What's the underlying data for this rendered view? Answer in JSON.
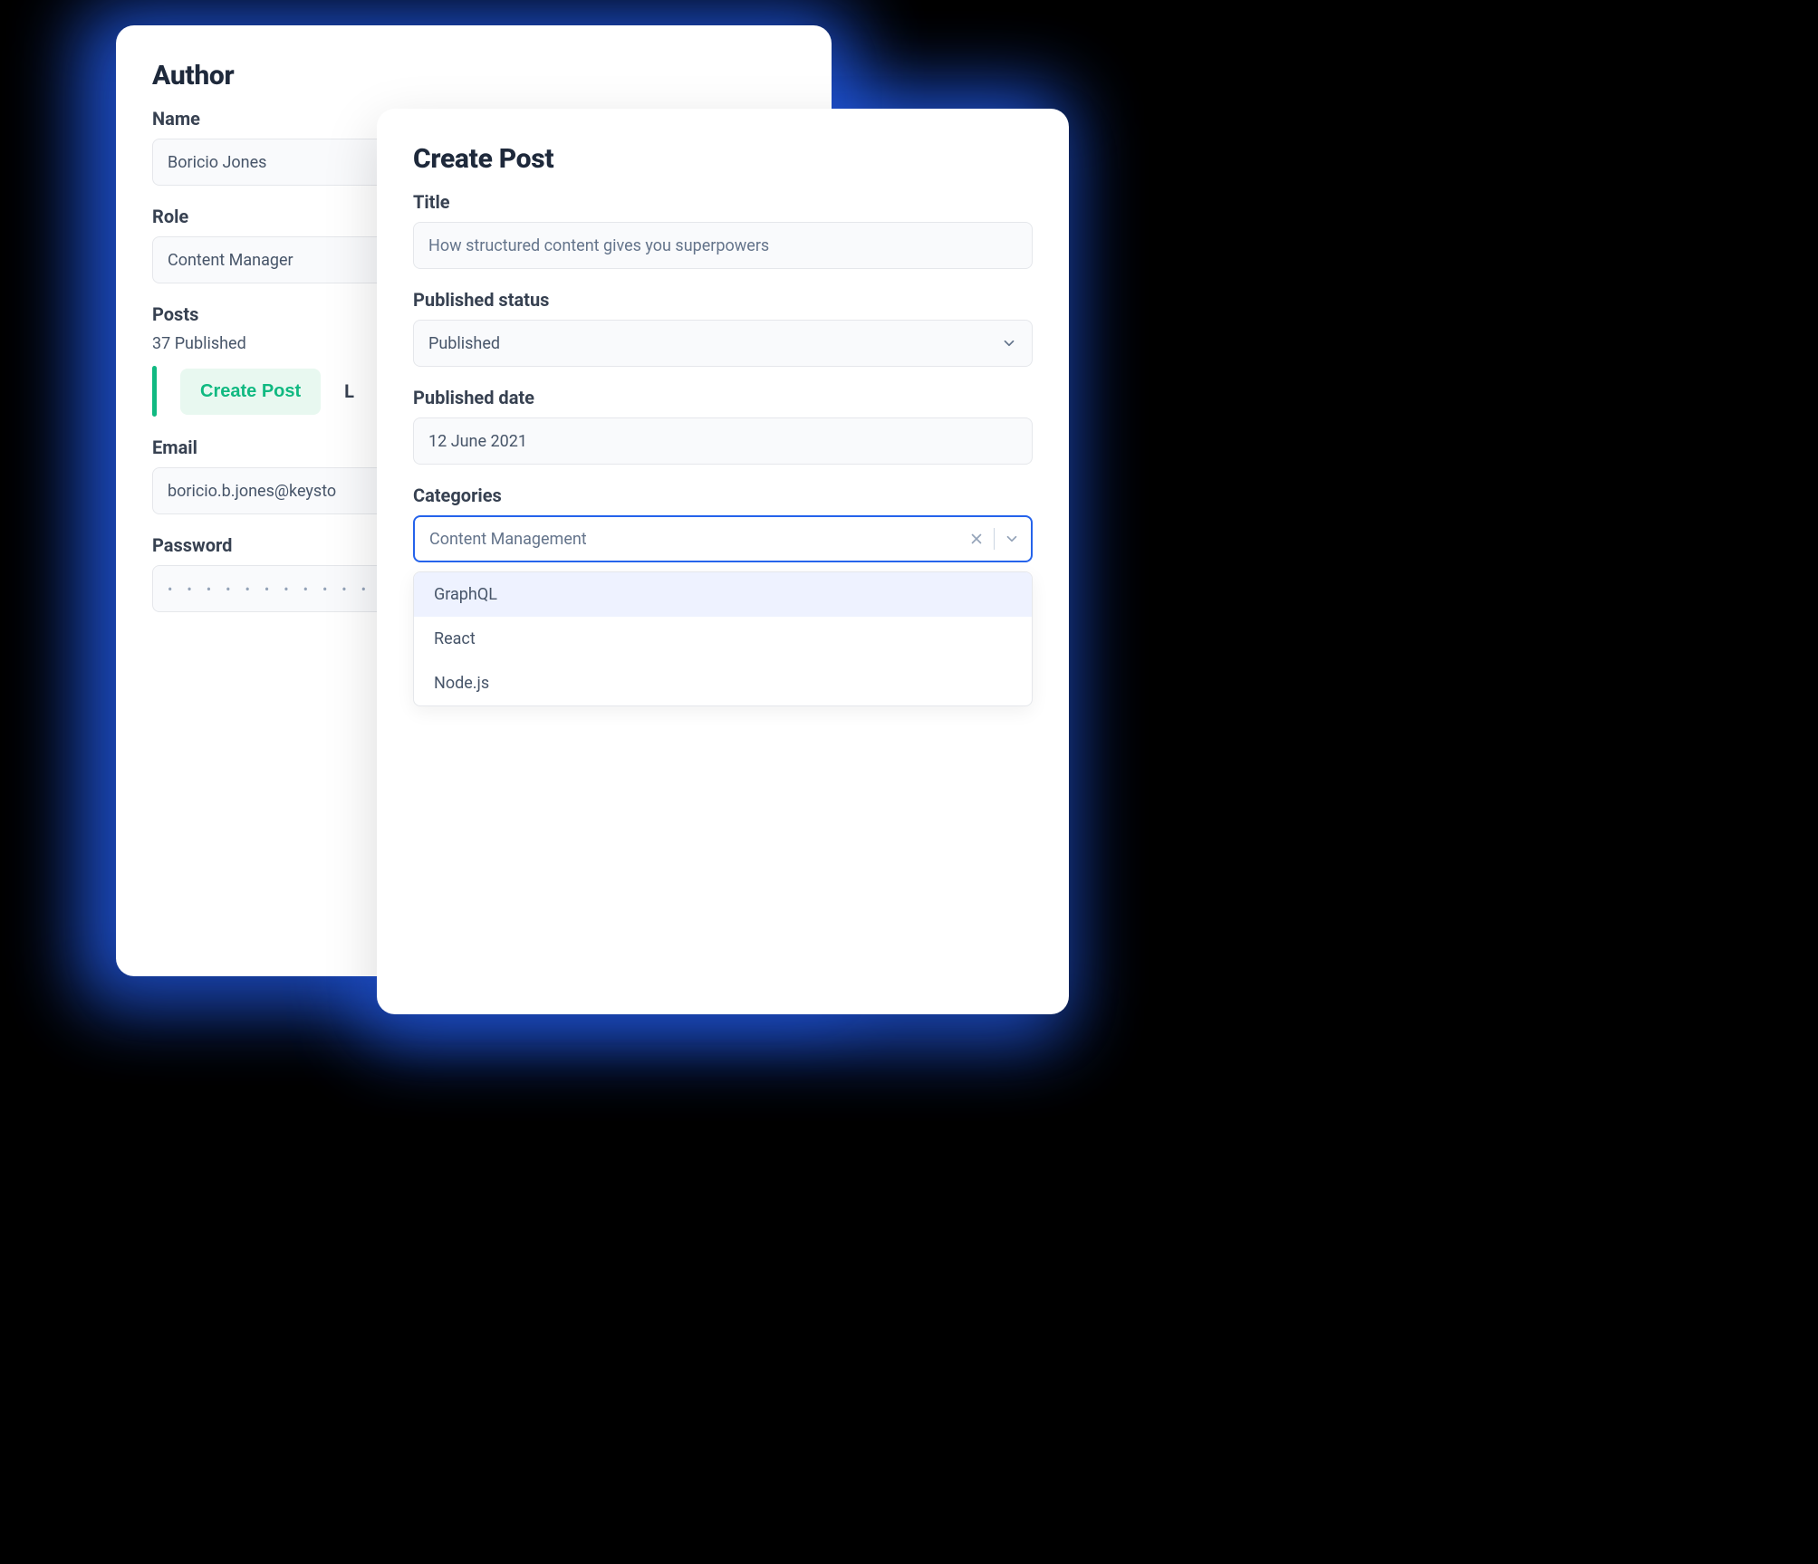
{
  "author": {
    "title": "Author",
    "name_label": "Name",
    "name_value": "Boricio Jones",
    "role_label": "Role",
    "role_value": "Content Manager",
    "posts_label": "Posts",
    "posts_meta": "37 Published",
    "create_post_label": "Create Post",
    "link_label": "L",
    "email_label": "Email",
    "email_value": "boricio.b.jones@keysto",
    "password_label": "Password",
    "password_mask": "• • • • • • • • • • • • • • • • • • • • • • • • • • •"
  },
  "post": {
    "title": "Create Post",
    "title_label": "Title",
    "title_value": "How structured content gives you superpowers",
    "status_label": "Published status",
    "status_value": "Published",
    "date_label": "Published date",
    "date_value": "12 June 2021",
    "categories_label": "Categories",
    "categories_value": "Content Management",
    "options": [
      "GraphQL",
      "React",
      "Node.js"
    ]
  }
}
